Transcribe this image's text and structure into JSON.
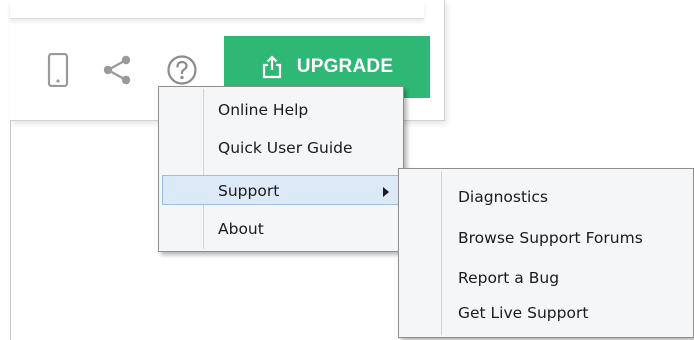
{
  "toolbar": {
    "icons": [
      "phone-icon",
      "share-icon",
      "help-icon"
    ],
    "upgrade_label": "UPGRADE",
    "upgrade_color": "#2fb875"
  },
  "help_menu": {
    "items": [
      {
        "label": "Online Help"
      },
      {
        "label": "Quick User Guide"
      },
      {
        "label": "Support",
        "has_submenu": true,
        "highlighted": true
      },
      {
        "label": "About"
      }
    ]
  },
  "support_submenu": {
    "items": [
      {
        "label": "Diagnostics"
      },
      {
        "label": "Browse Support Forums"
      },
      {
        "label": "Report a Bug"
      },
      {
        "label": "Get Live Support"
      }
    ]
  },
  "colors": {
    "menu_background": "#f4f6f8",
    "highlight_background": "#dce9f7",
    "highlight_border": "#9ebee6",
    "icon_gray": "#9a9a9a"
  }
}
